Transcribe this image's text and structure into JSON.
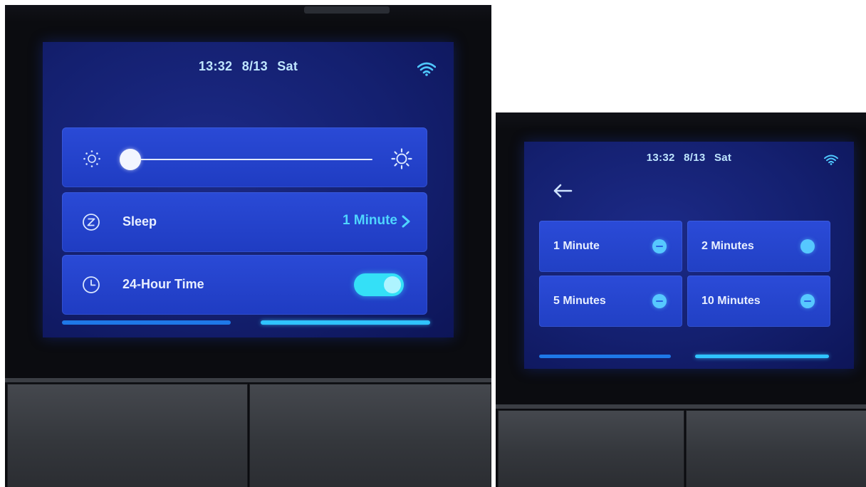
{
  "settings_screen": {
    "status": {
      "time": "13:32",
      "date": "8/13",
      "day": "Sat",
      "wifi_icon": "wifi-icon"
    },
    "brightness": {
      "level": 0.04,
      "min_icon": "sun-small-icon",
      "max_icon": "sun-large-icon"
    },
    "sleep": {
      "label": "Sleep",
      "value": "1 Minute",
      "icon": "sleep-z-icon"
    },
    "clock": {
      "label": "24-Hour Time",
      "enabled": true,
      "icon": "clock-icon"
    },
    "pager": {
      "pages": 2,
      "active": 2
    }
  },
  "sleep_screen": {
    "status": {
      "time": "13:32",
      "date": "8/13",
      "day": "Sat",
      "wifi_icon": "wifi-icon"
    },
    "back_icon": "back-arrow-icon",
    "options": [
      "1 Minute",
      "2 Minutes",
      "5 Minutes",
      "10 Minutes"
    ],
    "pager": {
      "pages": 2,
      "active": 2
    }
  },
  "colors": {
    "accent": "#2fc3ff",
    "card": "#2443cc",
    "screen": "#142070",
    "toggle_on": "#34e0f7"
  }
}
